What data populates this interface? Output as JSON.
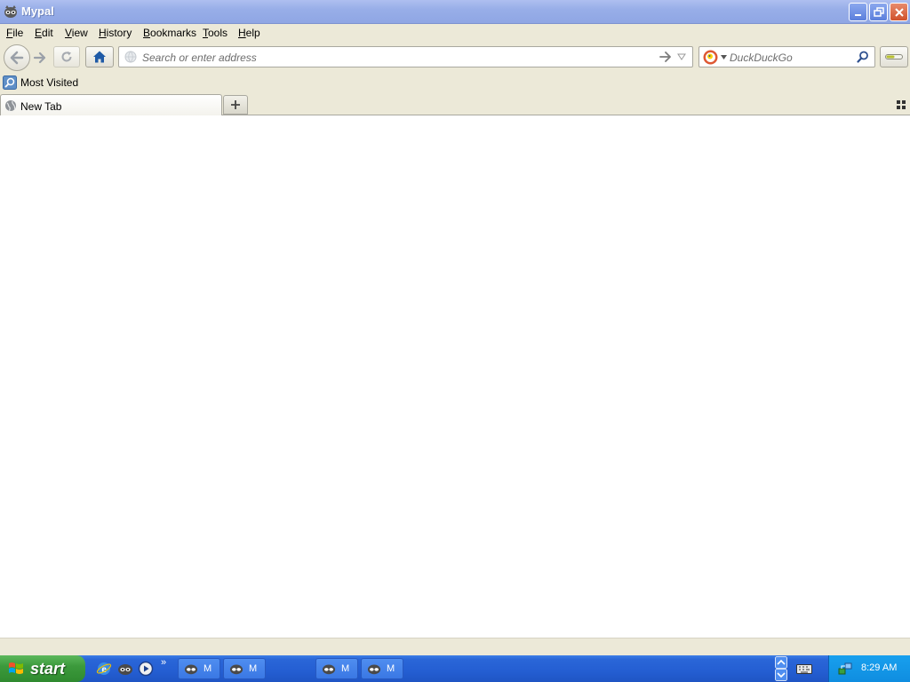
{
  "window": {
    "title": "Mypal"
  },
  "menu": [
    {
      "label": "File",
      "accel": "F",
      "rest": "ile"
    },
    {
      "label": "Edit",
      "accel": "E",
      "rest": "dit"
    },
    {
      "label": "View",
      "accel": "V",
      "rest": "iew"
    },
    {
      "label": "History",
      "accel": "H",
      "rest": "istory"
    },
    {
      "label": "Bookmarks",
      "accel": "B",
      "rest": "ookmarks"
    },
    {
      "label": "Tools",
      "accel": "T",
      "rest": "ools"
    },
    {
      "label": "Help",
      "accel": "H",
      "rest": "elp"
    }
  ],
  "navbar": {
    "url_placeholder": "Search or enter address",
    "url_value": "",
    "search_placeholder": "DuckDuckGo",
    "search_value": ""
  },
  "bookmarks": {
    "items": [
      {
        "label": "Most Visited"
      }
    ]
  },
  "tabs": [
    {
      "label": "New Tab",
      "selected": true
    }
  ],
  "taskbar": {
    "start_label": "start",
    "buttons": [
      {
        "label": "M",
        "pressed": false
      },
      {
        "label": "M",
        "pressed": false
      },
      {
        "label": "M",
        "pressed": false
      },
      {
        "label": "M",
        "pressed": false
      }
    ],
    "clock": "8:29 AM",
    "quicklaunch_chevron": "»"
  },
  "colors": {
    "titlebar": "#98aee8",
    "chrome": "#ece9d8",
    "taskbar": "#245ed2",
    "start": "#3c9a3c",
    "tray": "#0f8de0"
  }
}
